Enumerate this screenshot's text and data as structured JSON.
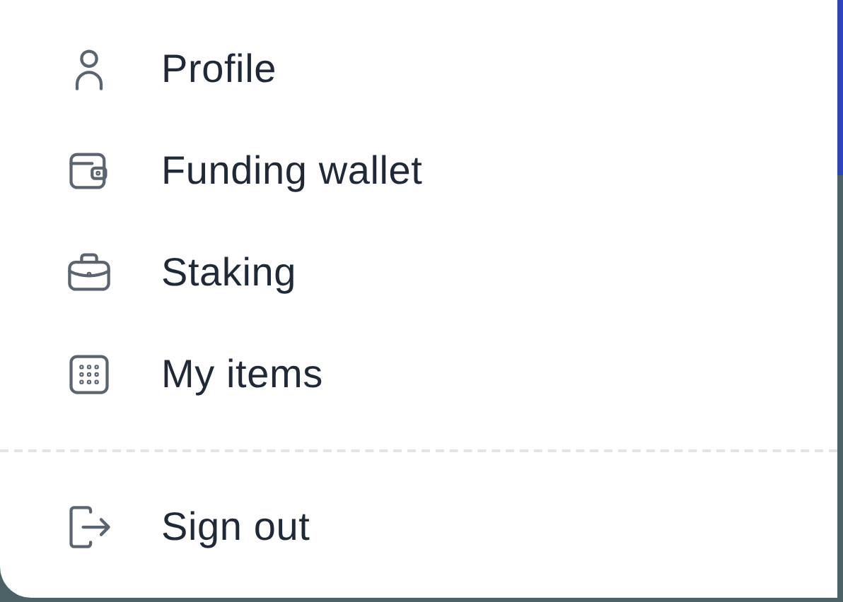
{
  "menu": {
    "items": [
      {
        "label": "Profile"
      },
      {
        "label": "Funding wallet"
      },
      {
        "label": "Staking"
      },
      {
        "label": "My items"
      }
    ],
    "footer_items": [
      {
        "label": "Sign out"
      }
    ]
  }
}
